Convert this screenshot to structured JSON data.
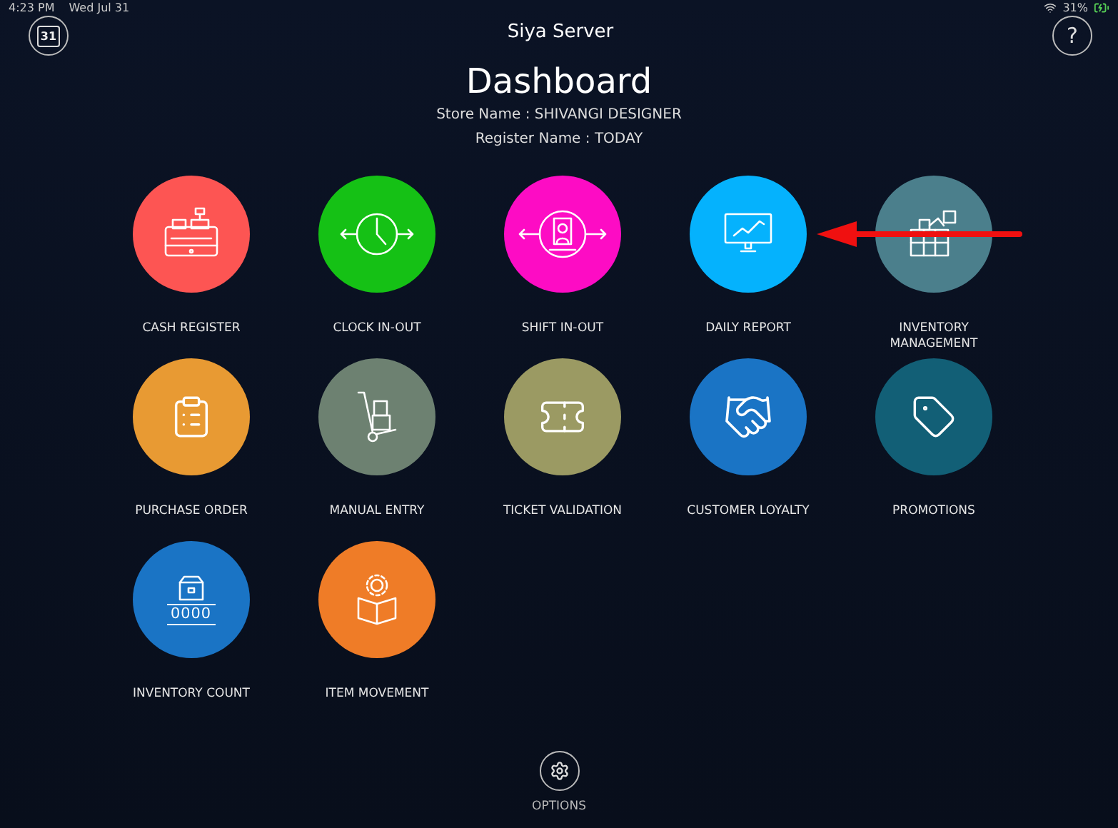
{
  "status_bar": {
    "time": "4:23 PM",
    "date": "Wed Jul 31",
    "battery": "31%"
  },
  "header": {
    "calendar_day": "31",
    "server": "Siya Server",
    "title": "Dashboard",
    "store": "Store Name : SHIVANGI DESIGNER",
    "register": "Register Name : TODAY",
    "help": "?"
  },
  "tiles": [
    {
      "label": "CASH REGISTER",
      "kind": "register",
      "color": "#fd5553"
    },
    {
      "label": "CLOCK IN-OUT",
      "kind": "clock",
      "color": "#15c115"
    },
    {
      "label": "SHIFT IN-OUT",
      "kind": "shift",
      "color": "#fd0cc4"
    },
    {
      "label": "DAILY REPORT",
      "kind": "report",
      "color": "#05b2fd"
    },
    {
      "label": "INVENTORY MANAGEMENT",
      "kind": "inventory",
      "color": "#4b7f8c"
    },
    {
      "label": "PURCHASE ORDER",
      "kind": "clipboard",
      "color": "#e89a33"
    },
    {
      "label": "MANUAL ENTRY",
      "kind": "handtruck",
      "color": "#6d8171"
    },
    {
      "label": "TICKET VALIDATION",
      "kind": "ticket",
      "color": "#9b9a63"
    },
    {
      "label": "CUSTOMER LOYALTY",
      "kind": "handshake",
      "color": "#1a74c5"
    },
    {
      "label": "PROMOTIONS",
      "kind": "tag",
      "color": "#125f76"
    },
    {
      "label": "INVENTORY COUNT",
      "kind": "count",
      "color": "#1a74c5",
      "icon_text": "0000"
    },
    {
      "label": "ITEM MOVEMENT",
      "kind": "movement",
      "color": "#ef7c27"
    }
  ],
  "options": {
    "label": "OPTIONS"
  }
}
